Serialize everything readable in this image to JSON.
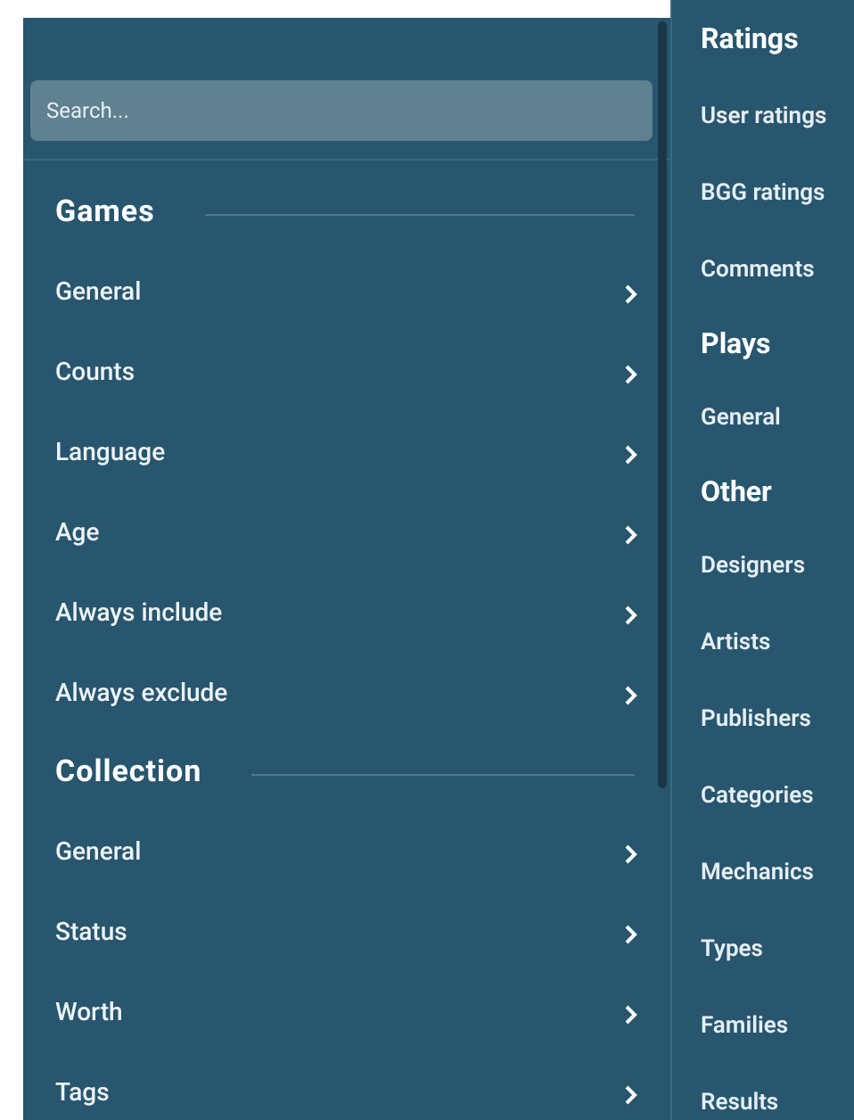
{
  "search": {
    "placeholder": "Search..."
  },
  "left_sections": [
    {
      "title": "Games",
      "items": [
        {
          "label": "General"
        },
        {
          "label": "Counts"
        },
        {
          "label": "Language"
        },
        {
          "label": "Age"
        },
        {
          "label": "Always include"
        },
        {
          "label": "Always exclude"
        }
      ]
    },
    {
      "title": "Collection",
      "items": [
        {
          "label": "General"
        },
        {
          "label": "Status"
        },
        {
          "label": "Worth"
        },
        {
          "label": "Tags"
        }
      ]
    }
  ],
  "right_sections": [
    {
      "title": "Ratings",
      "items": [
        {
          "label": "User ratings"
        },
        {
          "label": "BGG ratings"
        },
        {
          "label": "Comments"
        }
      ]
    },
    {
      "title": "Plays",
      "items": [
        {
          "label": "General"
        }
      ]
    },
    {
      "title": "Other",
      "items": [
        {
          "label": "Designers"
        },
        {
          "label": "Artists"
        },
        {
          "label": "Publishers"
        },
        {
          "label": "Categories"
        },
        {
          "label": "Mechanics"
        },
        {
          "label": "Types"
        },
        {
          "label": "Families"
        },
        {
          "label": "Results"
        }
      ]
    }
  ]
}
